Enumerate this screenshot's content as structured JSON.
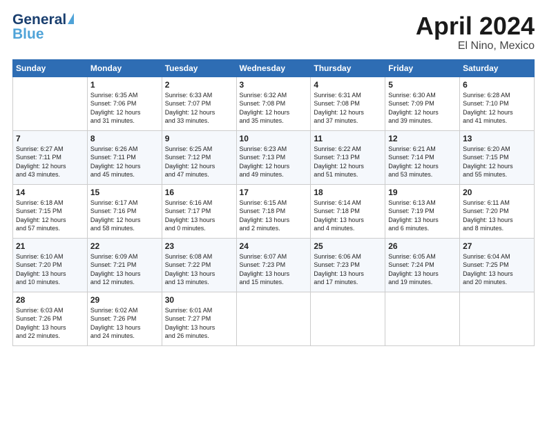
{
  "logo": {
    "line1": "General",
    "line2": "Blue"
  },
  "title": "April 2024",
  "location": "El Nino, Mexico",
  "weekdays": [
    "Sunday",
    "Monday",
    "Tuesday",
    "Wednesday",
    "Thursday",
    "Friday",
    "Saturday"
  ],
  "weeks": [
    [
      {
        "day": "",
        "info": ""
      },
      {
        "day": "1",
        "info": "Sunrise: 6:35 AM\nSunset: 7:06 PM\nDaylight: 12 hours\nand 31 minutes."
      },
      {
        "day": "2",
        "info": "Sunrise: 6:33 AM\nSunset: 7:07 PM\nDaylight: 12 hours\nand 33 minutes."
      },
      {
        "day": "3",
        "info": "Sunrise: 6:32 AM\nSunset: 7:08 PM\nDaylight: 12 hours\nand 35 minutes."
      },
      {
        "day": "4",
        "info": "Sunrise: 6:31 AM\nSunset: 7:08 PM\nDaylight: 12 hours\nand 37 minutes."
      },
      {
        "day": "5",
        "info": "Sunrise: 6:30 AM\nSunset: 7:09 PM\nDaylight: 12 hours\nand 39 minutes."
      },
      {
        "day": "6",
        "info": "Sunrise: 6:28 AM\nSunset: 7:10 PM\nDaylight: 12 hours\nand 41 minutes."
      }
    ],
    [
      {
        "day": "7",
        "info": "Sunrise: 6:27 AM\nSunset: 7:11 PM\nDaylight: 12 hours\nand 43 minutes."
      },
      {
        "day": "8",
        "info": "Sunrise: 6:26 AM\nSunset: 7:11 PM\nDaylight: 12 hours\nand 45 minutes."
      },
      {
        "day": "9",
        "info": "Sunrise: 6:25 AM\nSunset: 7:12 PM\nDaylight: 12 hours\nand 47 minutes."
      },
      {
        "day": "10",
        "info": "Sunrise: 6:23 AM\nSunset: 7:13 PM\nDaylight: 12 hours\nand 49 minutes."
      },
      {
        "day": "11",
        "info": "Sunrise: 6:22 AM\nSunset: 7:13 PM\nDaylight: 12 hours\nand 51 minutes."
      },
      {
        "day": "12",
        "info": "Sunrise: 6:21 AM\nSunset: 7:14 PM\nDaylight: 12 hours\nand 53 minutes."
      },
      {
        "day": "13",
        "info": "Sunrise: 6:20 AM\nSunset: 7:15 PM\nDaylight: 12 hours\nand 55 minutes."
      }
    ],
    [
      {
        "day": "14",
        "info": "Sunrise: 6:18 AM\nSunset: 7:15 PM\nDaylight: 12 hours\nand 57 minutes."
      },
      {
        "day": "15",
        "info": "Sunrise: 6:17 AM\nSunset: 7:16 PM\nDaylight: 12 hours\nand 58 minutes."
      },
      {
        "day": "16",
        "info": "Sunrise: 6:16 AM\nSunset: 7:17 PM\nDaylight: 13 hours\nand 0 minutes."
      },
      {
        "day": "17",
        "info": "Sunrise: 6:15 AM\nSunset: 7:18 PM\nDaylight: 13 hours\nand 2 minutes."
      },
      {
        "day": "18",
        "info": "Sunrise: 6:14 AM\nSunset: 7:18 PM\nDaylight: 13 hours\nand 4 minutes."
      },
      {
        "day": "19",
        "info": "Sunrise: 6:13 AM\nSunset: 7:19 PM\nDaylight: 13 hours\nand 6 minutes."
      },
      {
        "day": "20",
        "info": "Sunrise: 6:11 AM\nSunset: 7:20 PM\nDaylight: 13 hours\nand 8 minutes."
      }
    ],
    [
      {
        "day": "21",
        "info": "Sunrise: 6:10 AM\nSunset: 7:20 PM\nDaylight: 13 hours\nand 10 minutes."
      },
      {
        "day": "22",
        "info": "Sunrise: 6:09 AM\nSunset: 7:21 PM\nDaylight: 13 hours\nand 12 minutes."
      },
      {
        "day": "23",
        "info": "Sunrise: 6:08 AM\nSunset: 7:22 PM\nDaylight: 13 hours\nand 13 minutes."
      },
      {
        "day": "24",
        "info": "Sunrise: 6:07 AM\nSunset: 7:23 PM\nDaylight: 13 hours\nand 15 minutes."
      },
      {
        "day": "25",
        "info": "Sunrise: 6:06 AM\nSunset: 7:23 PM\nDaylight: 13 hours\nand 17 minutes."
      },
      {
        "day": "26",
        "info": "Sunrise: 6:05 AM\nSunset: 7:24 PM\nDaylight: 13 hours\nand 19 minutes."
      },
      {
        "day": "27",
        "info": "Sunrise: 6:04 AM\nSunset: 7:25 PM\nDaylight: 13 hours\nand 20 minutes."
      }
    ],
    [
      {
        "day": "28",
        "info": "Sunrise: 6:03 AM\nSunset: 7:26 PM\nDaylight: 13 hours\nand 22 minutes."
      },
      {
        "day": "29",
        "info": "Sunrise: 6:02 AM\nSunset: 7:26 PM\nDaylight: 13 hours\nand 24 minutes."
      },
      {
        "day": "30",
        "info": "Sunrise: 6:01 AM\nSunset: 7:27 PM\nDaylight: 13 hours\nand 26 minutes."
      },
      {
        "day": "",
        "info": ""
      },
      {
        "day": "",
        "info": ""
      },
      {
        "day": "",
        "info": ""
      },
      {
        "day": "",
        "info": ""
      }
    ]
  ]
}
